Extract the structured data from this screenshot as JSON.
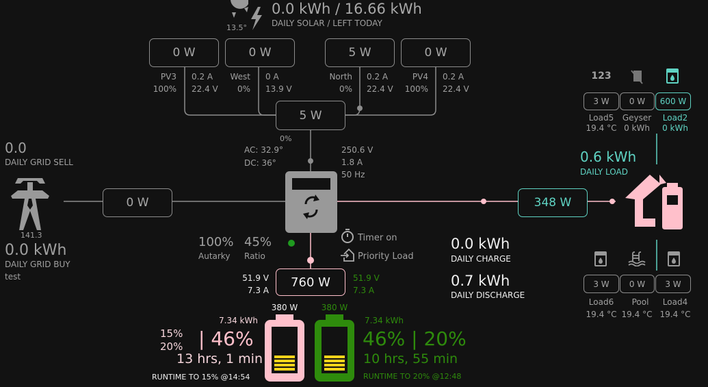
{
  "solar": {
    "headline": "0.0 kWh / 16.66 kWh",
    "subtitle": "DAILY SOLAR / LEFT TODAY",
    "temperature": "13.5°",
    "total": "5 W",
    "total_percent": "0%",
    "panels": [
      {
        "name": "PV3",
        "power": "0 W",
        "percent": "100%",
        "current": "0.2 A",
        "voltage": "22.4 V"
      },
      {
        "name": "West",
        "power": "0 W",
        "percent": "0%",
        "current": "0 A",
        "voltage": "13.9 V"
      },
      {
        "name": "North",
        "power": "5 W",
        "percent": "0%",
        "current": "0.2 A",
        "voltage": "22.4 V"
      },
      {
        "name": "PV4",
        "power": "0 W",
        "percent": "100%",
        "current": "0.2 A",
        "voltage": "22.4 V"
      }
    ]
  },
  "grid": {
    "daily_sell": "0.0",
    "daily_sell_label": "DAILY GRID SELL",
    "tower_value": "141.3",
    "daily_buy": "0.0 kWh",
    "daily_buy_label": "DAILY GRID BUY",
    "note": "test",
    "power": "0 W"
  },
  "inverter": {
    "ac_temp": "AC: 32.9°",
    "dc_temp": "DC: 36°",
    "voltage": "250.6 V",
    "current": "1.8 A",
    "frequency": "50 Hz",
    "autarky_value": "100%",
    "autarky_label": "Autarky",
    "ratio_value": "45%",
    "ratio_label": "Ratio",
    "timer": "Timer on",
    "priority": "Priority Load"
  },
  "battery": {
    "power": "760 W",
    "left_voltage": "51.9 V",
    "left_current": "7.3 A",
    "right_voltage": "51.9 V",
    "right_current": "7.3 A",
    "daily_charge": "0.0 kWh",
    "daily_charge_label": "DAILY CHARGE",
    "daily_discharge": "0.7 kWh",
    "daily_discharge_label": "DAILY DISCHARGE",
    "bat1": {
      "power": "380 W",
      "energy": "7.34 kWh",
      "limit1": "15%",
      "limit2": "20%",
      "soc": "| 46%",
      "runtime": "13 hrs, 1 min",
      "runtime_label": "RUNTIME TO 15% @14:54"
    },
    "bat2": {
      "power": "380 W",
      "energy": "7.34 kWh",
      "soc": "46% | 20%",
      "runtime": "10 hrs, 55 min",
      "runtime_label": "RUNTIME TO 20% @12:48"
    }
  },
  "load": {
    "power": "348 W",
    "daily": "0.6 kWh",
    "daily_label": "DAILY LOAD",
    "top": [
      {
        "name": "Load5",
        "power": "3 W",
        "info": "19.4 °C",
        "icon": "123"
      },
      {
        "name": "Geyser",
        "power": "0 W",
        "info": "0 kWh"
      },
      {
        "name": "Load2",
        "power": "600 W",
        "info": "0 kWh"
      }
    ],
    "bottom": [
      {
        "name": "Load6",
        "power": "3 W",
        "info": "19.4 °C"
      },
      {
        "name": "Pool",
        "power": "0 W",
        "info": "19.4 °C"
      },
      {
        "name": "Load4",
        "power": "3 W",
        "info": "19.4 °C"
      }
    ]
  },
  "colors": {
    "pink": "#ffc0cb",
    "teal": "#5fd3c3",
    "green": "#2e8b0c",
    "gray": "#999999",
    "background": "#121212"
  }
}
